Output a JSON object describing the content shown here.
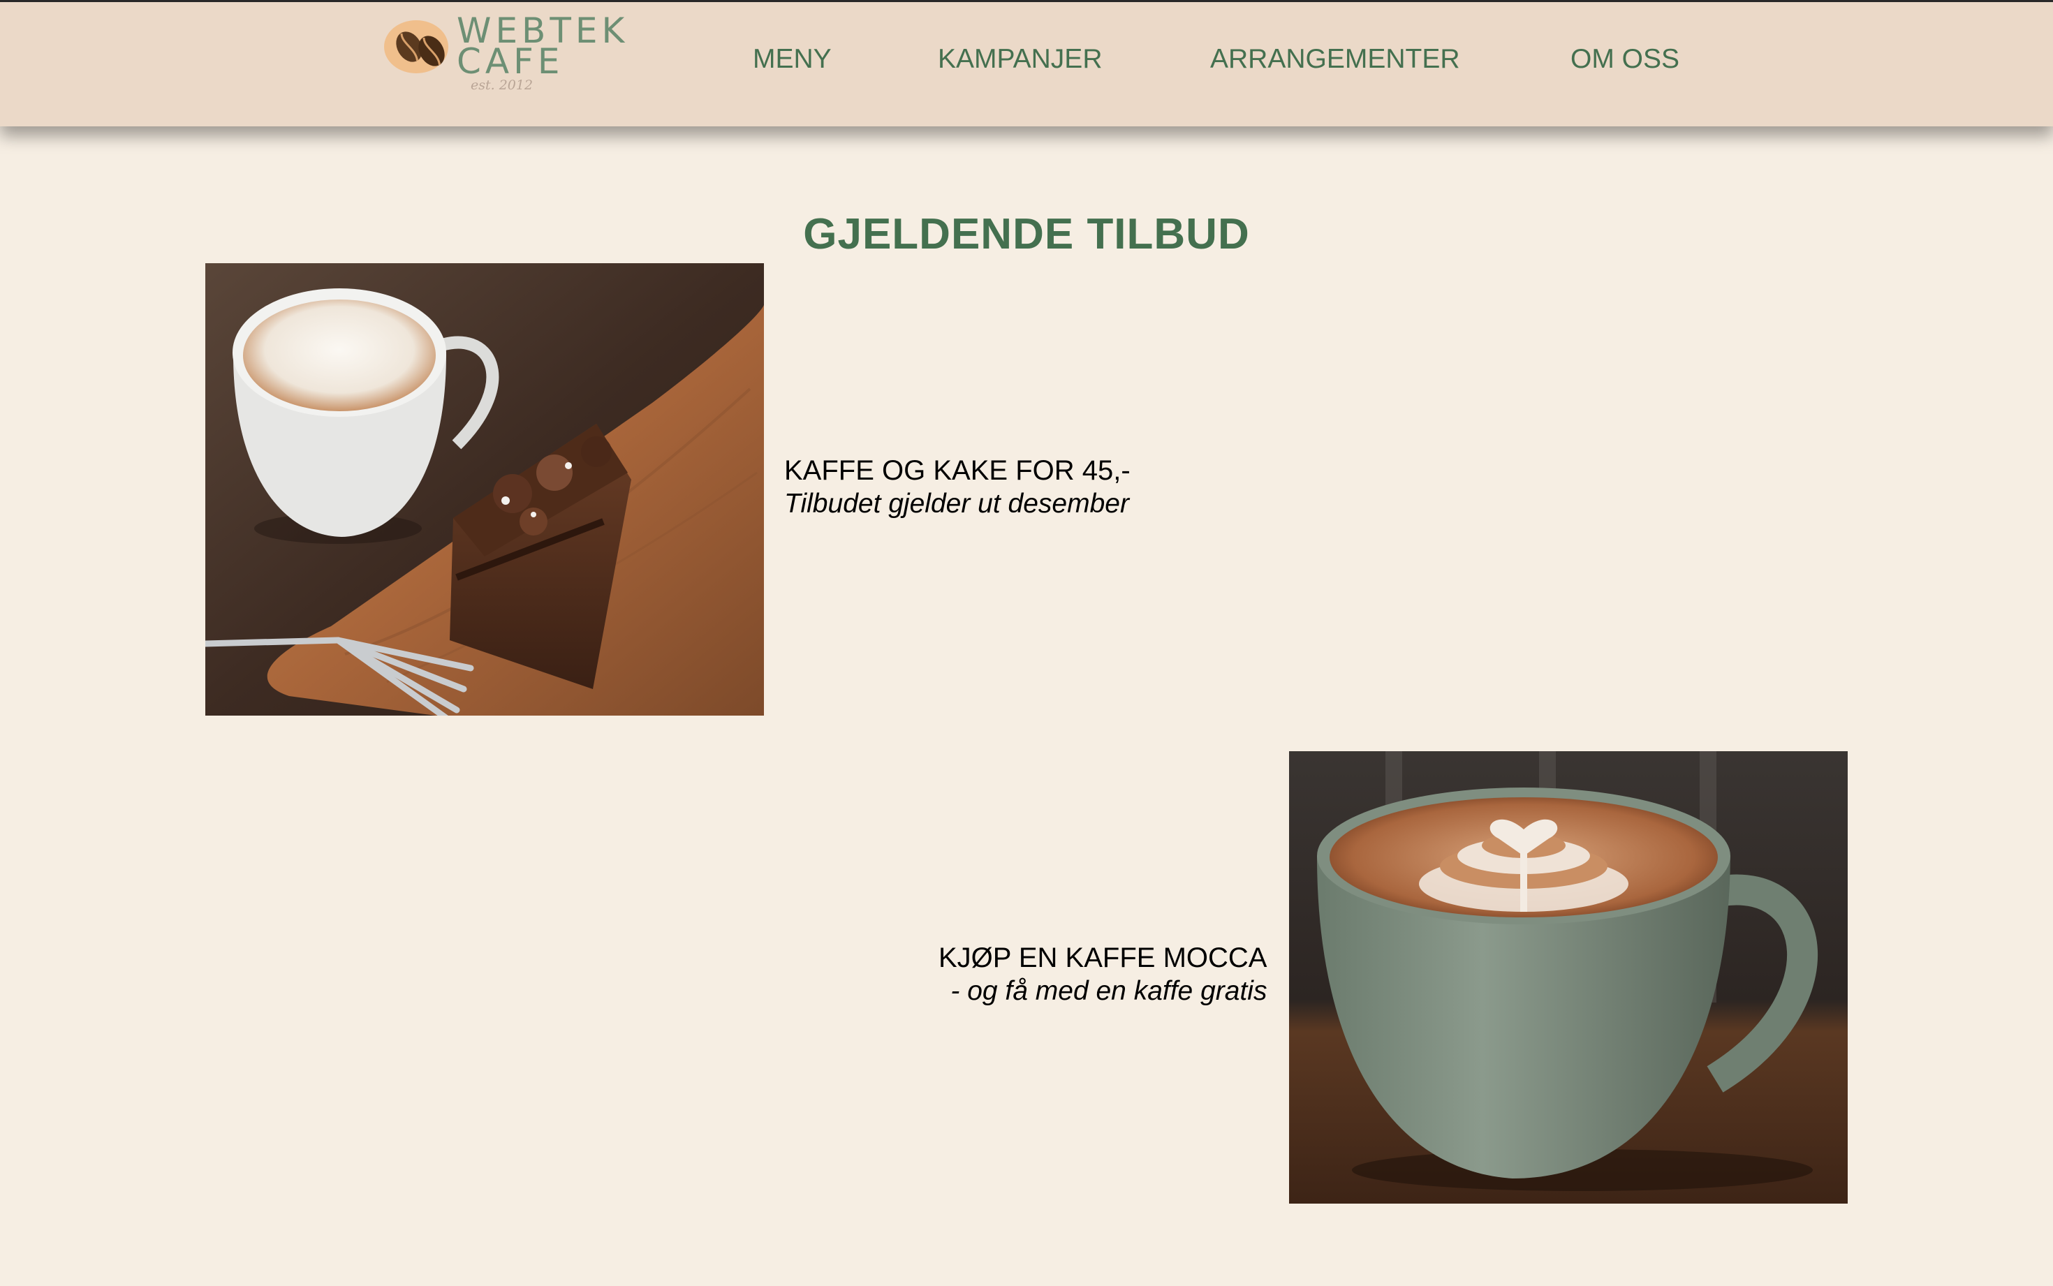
{
  "header": {
    "logo": {
      "line1": "WEBTEK",
      "line2": "CAFE",
      "est": "est. 2012"
    },
    "nav": [
      {
        "label": "MENY"
      },
      {
        "label": "KAMPANJER"
      },
      {
        "label": "ARRANGEMENTER"
      },
      {
        "label": "OM OSS"
      }
    ]
  },
  "main": {
    "title": "GJELDENDE TILBUD",
    "offers": [
      {
        "title": "KAFFE OG KAKE FOR 45,-",
        "subtitle": "Tilbudet gjelder ut desember",
        "image": "coffee-and-chocolate-cake-photo"
      },
      {
        "title": "KJØP EN KAFFE MOCCA",
        "subtitle": "- og få med en kaffe gratis",
        "image": "latte-art-green-cup-photo"
      }
    ]
  },
  "colors": {
    "background": "#f6eee3",
    "header": "#ebd9c8",
    "accent_green": "#44704f",
    "text": "#000000"
  }
}
